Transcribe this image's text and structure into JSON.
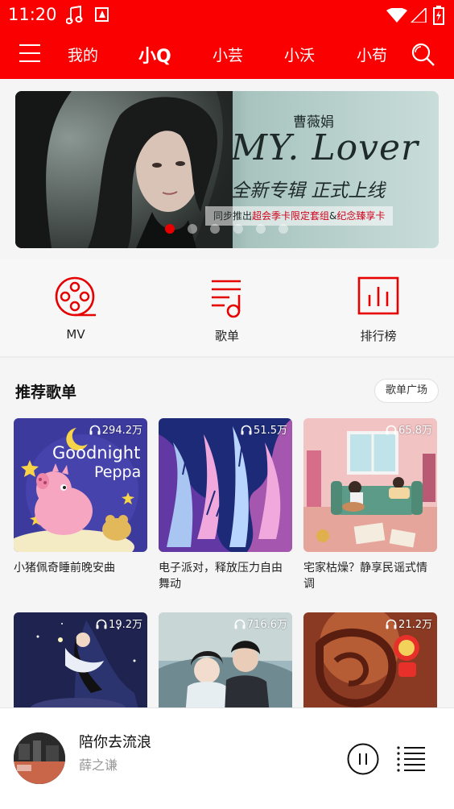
{
  "status_bar": {
    "time": "11:20"
  },
  "nav": {
    "tabs": [
      {
        "label": "我的",
        "active": false
      },
      {
        "label": "小Q",
        "active": true
      },
      {
        "label": "小芸",
        "active": false
      },
      {
        "label": "小沃",
        "active": false
      },
      {
        "label": "小苟",
        "active": false
      }
    ],
    "menu_icon": "hamburger-menu-icon",
    "search_icon": "search-icon"
  },
  "banner": {
    "artist": "曹薇娟",
    "title": "MY. Lover",
    "subtitle": "全新专辑 正式上线",
    "promo_prefix": "同步推出",
    "promo_highlight_1": "超会季卡限定套组",
    "promo_amp": "&",
    "promo_highlight_2": "纪念臻享卡",
    "active_slide": 0,
    "slide_count": 6
  },
  "quick_entries": [
    {
      "label": "MV",
      "icon": "film-reel-icon"
    },
    {
      "label": "歌单",
      "icon": "music-list-icon"
    },
    {
      "label": "排行榜",
      "icon": "bar-chart-icon"
    }
  ],
  "recommend": {
    "title": "推荐歌单",
    "more_label": "歌单广场",
    "playlists": [
      {
        "title": "小猪佩奇睡前晚安曲",
        "plays": "294.2万",
        "cover_text_1": "Goodnight",
        "cover_text_2": "Peppa"
      },
      {
        "title": "电子派对，释放压力自由舞动",
        "plays": "51.5万"
      },
      {
        "title": "宅家枯燥？静享民谣式情调",
        "plays": "65.8万"
      },
      {
        "title": "",
        "plays": "19.2万"
      },
      {
        "title": "",
        "plays": "716.6万"
      },
      {
        "title": "",
        "plays": "21.2万"
      }
    ]
  },
  "player": {
    "song": "陪你去流浪",
    "artist": "薛之谦"
  },
  "colors": {
    "brand_red": "#fb0000",
    "accent_red": "#e60000"
  }
}
